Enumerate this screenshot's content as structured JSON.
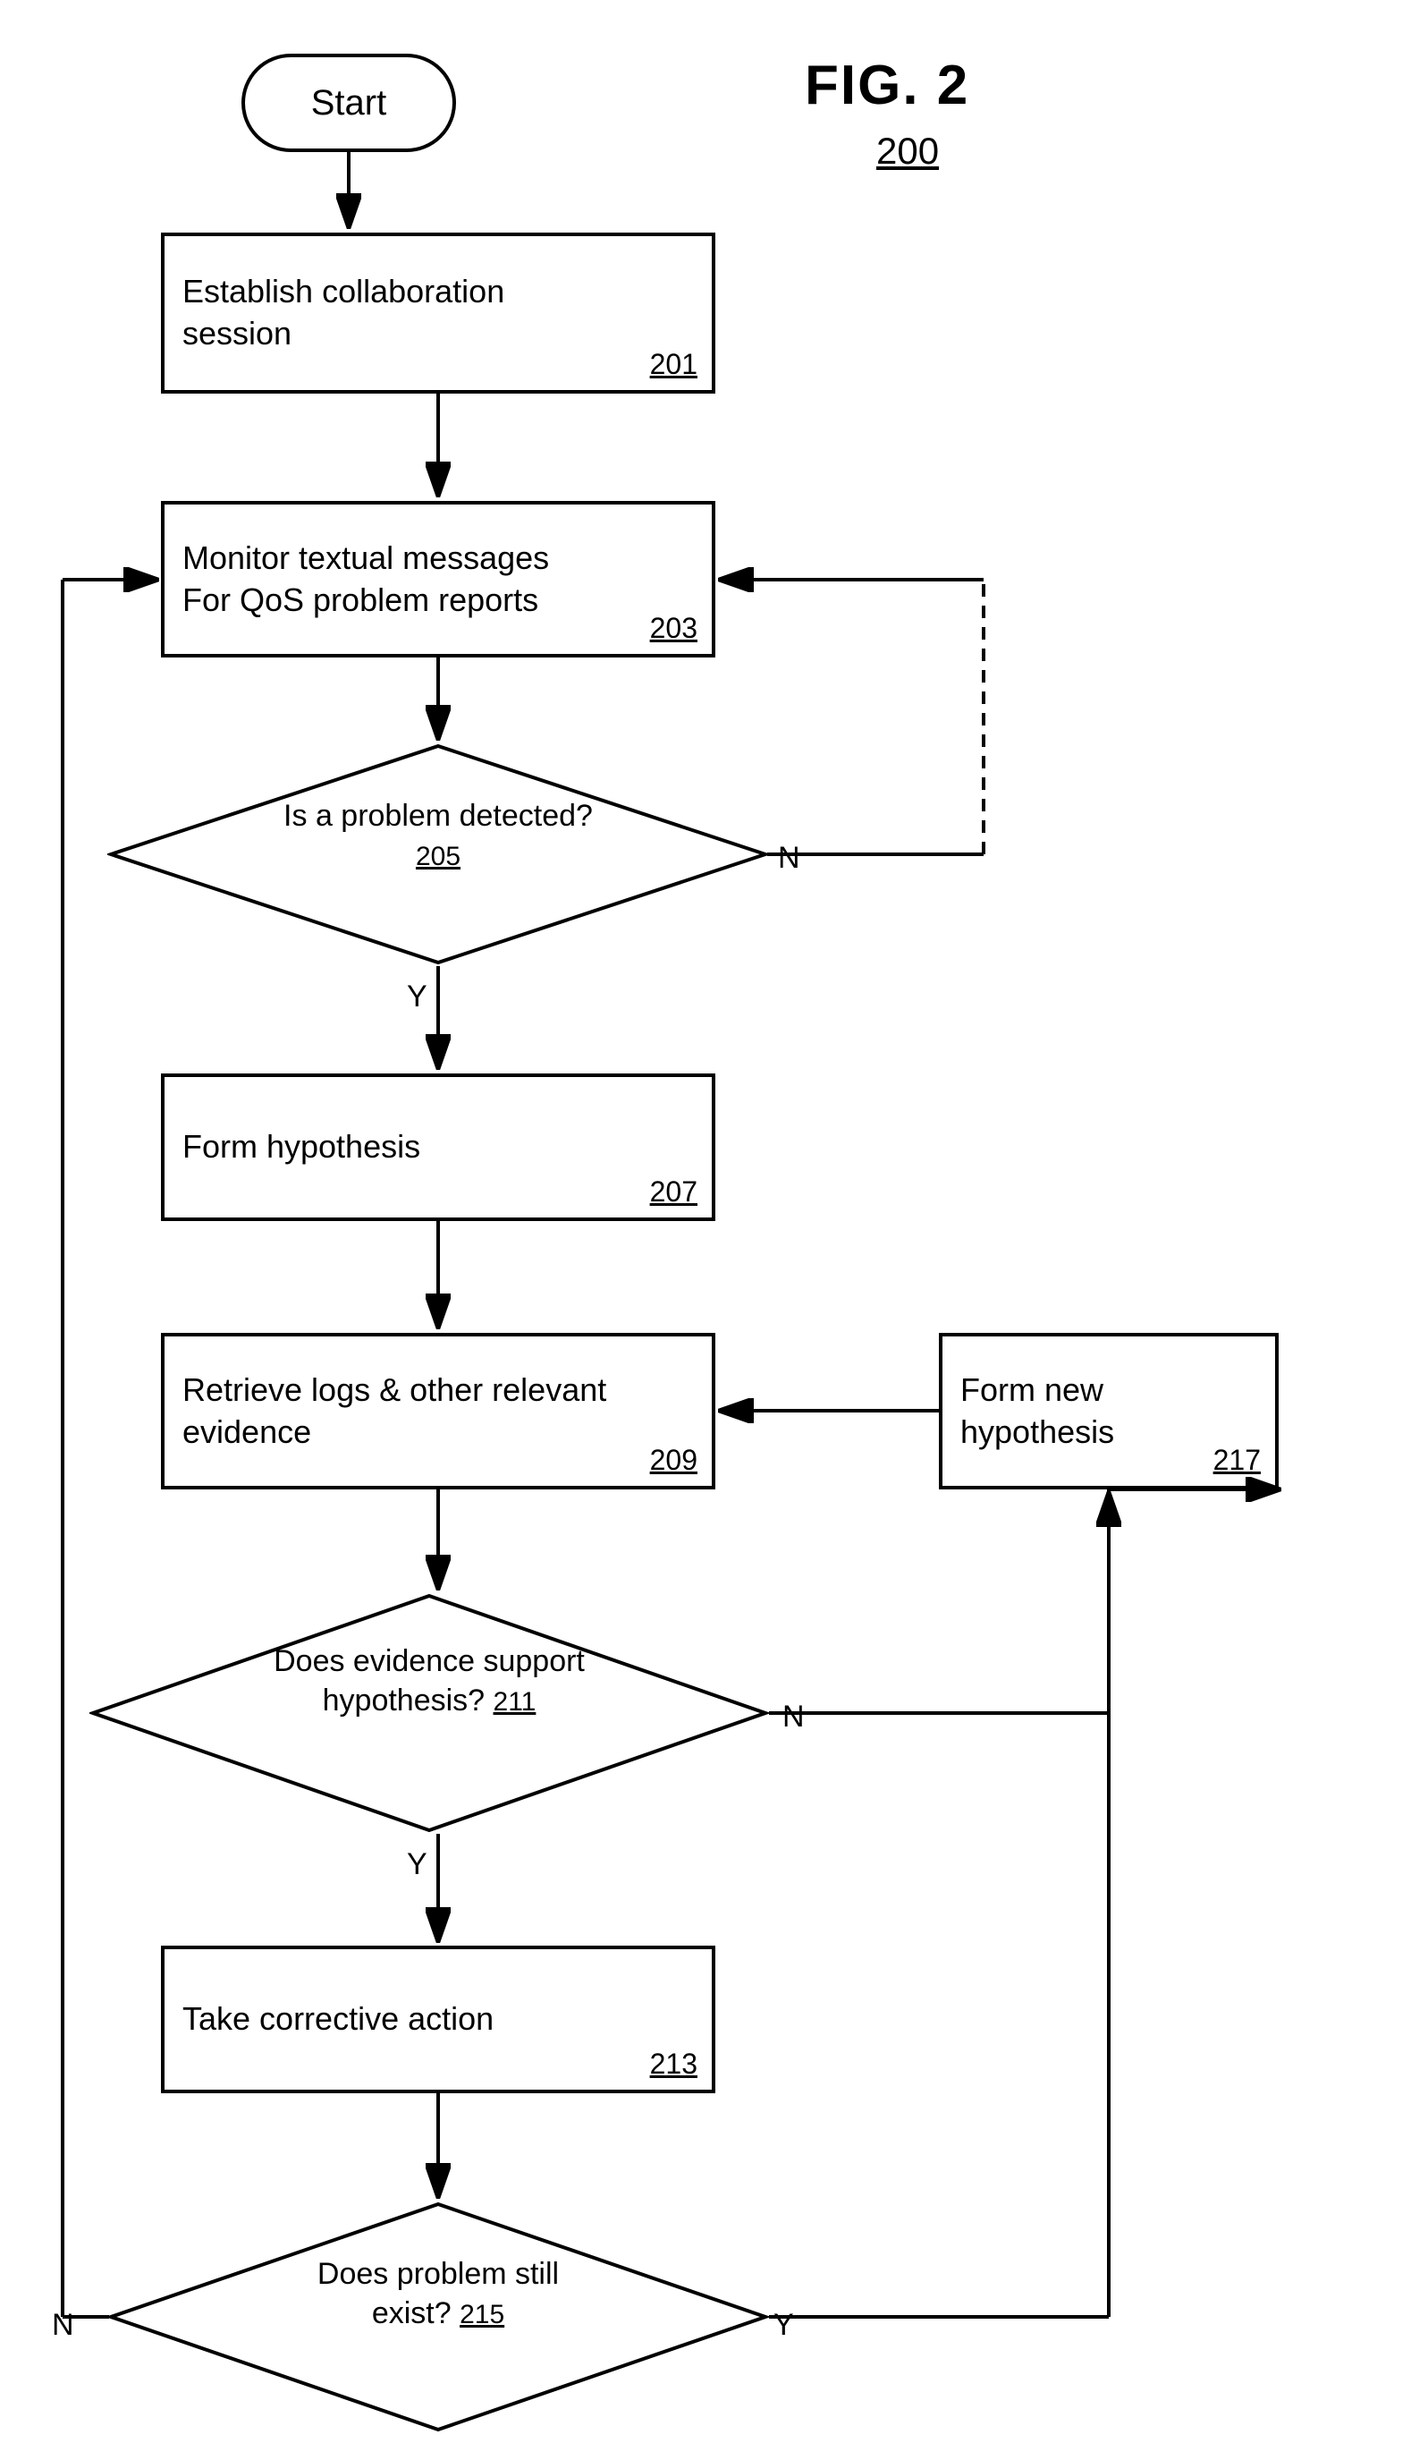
{
  "title": "FIG. 2",
  "ref": "200",
  "start_label": "Start",
  "boxes": {
    "establish": {
      "label": "Establish collaboration\nsession",
      "num": "201"
    },
    "monitor": {
      "label": "Monitor textual messages\nFor QoS problem reports",
      "num": "203"
    },
    "form_hypothesis": {
      "label": "Form hypothesis",
      "num": "207"
    },
    "retrieve_logs": {
      "label": "Retrieve logs & other relevant\nevidence",
      "num": "209"
    },
    "corrective_action": {
      "label": "Take corrective action",
      "num": "213"
    },
    "form_new_hypothesis": {
      "label": "Form new\nhypothesis",
      "num": "217"
    }
  },
  "diamonds": {
    "problem_detected": {
      "label": "Is a problem detected?",
      "num": "205",
      "yes": "Y",
      "no": "N"
    },
    "evidence_support": {
      "label": "Does evidence support\nhypothesis?",
      "num": "211",
      "yes": "Y",
      "no": "N"
    },
    "problem_still_exist": {
      "label": "Does problem still\nexist?",
      "num": "215",
      "yes": "Y",
      "no": "N"
    }
  }
}
